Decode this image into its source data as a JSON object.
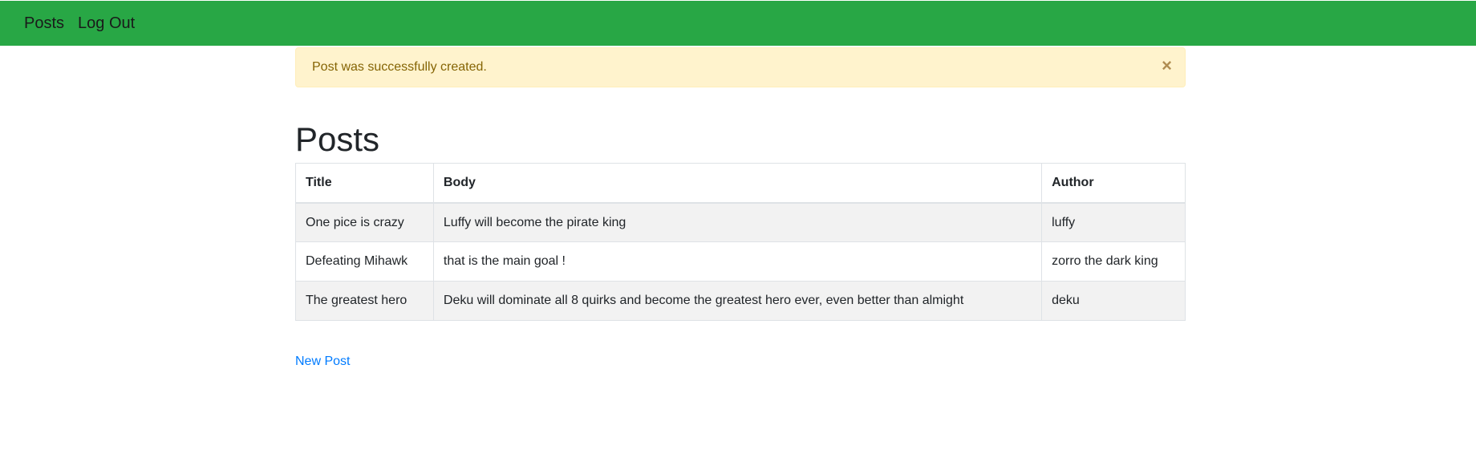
{
  "navbar": {
    "items": [
      {
        "label": "Posts"
      },
      {
        "label": "Log Out"
      }
    ],
    "color": "#28a745"
  },
  "alert": {
    "message": "Post was successfully created.",
    "close_symbol": "×",
    "color": "#fff3cd"
  },
  "page": {
    "title": "Posts"
  },
  "table": {
    "headers": [
      "Title",
      "Body",
      "Author"
    ],
    "rows": [
      [
        "One pice is crazy",
        "Luffy will become the pirate king",
        "luffy"
      ],
      [
        "Defeating Mihawk",
        "that is the main goal !",
        "zorro the dark king"
      ],
      [
        "The greatest hero",
        "Deku will dominate all 8 quirks and become the greatest hero ever, even better than almight",
        "deku"
      ]
    ]
  },
  "actions": {
    "new_post_label": "New Post",
    "link_color": "#007bff"
  }
}
